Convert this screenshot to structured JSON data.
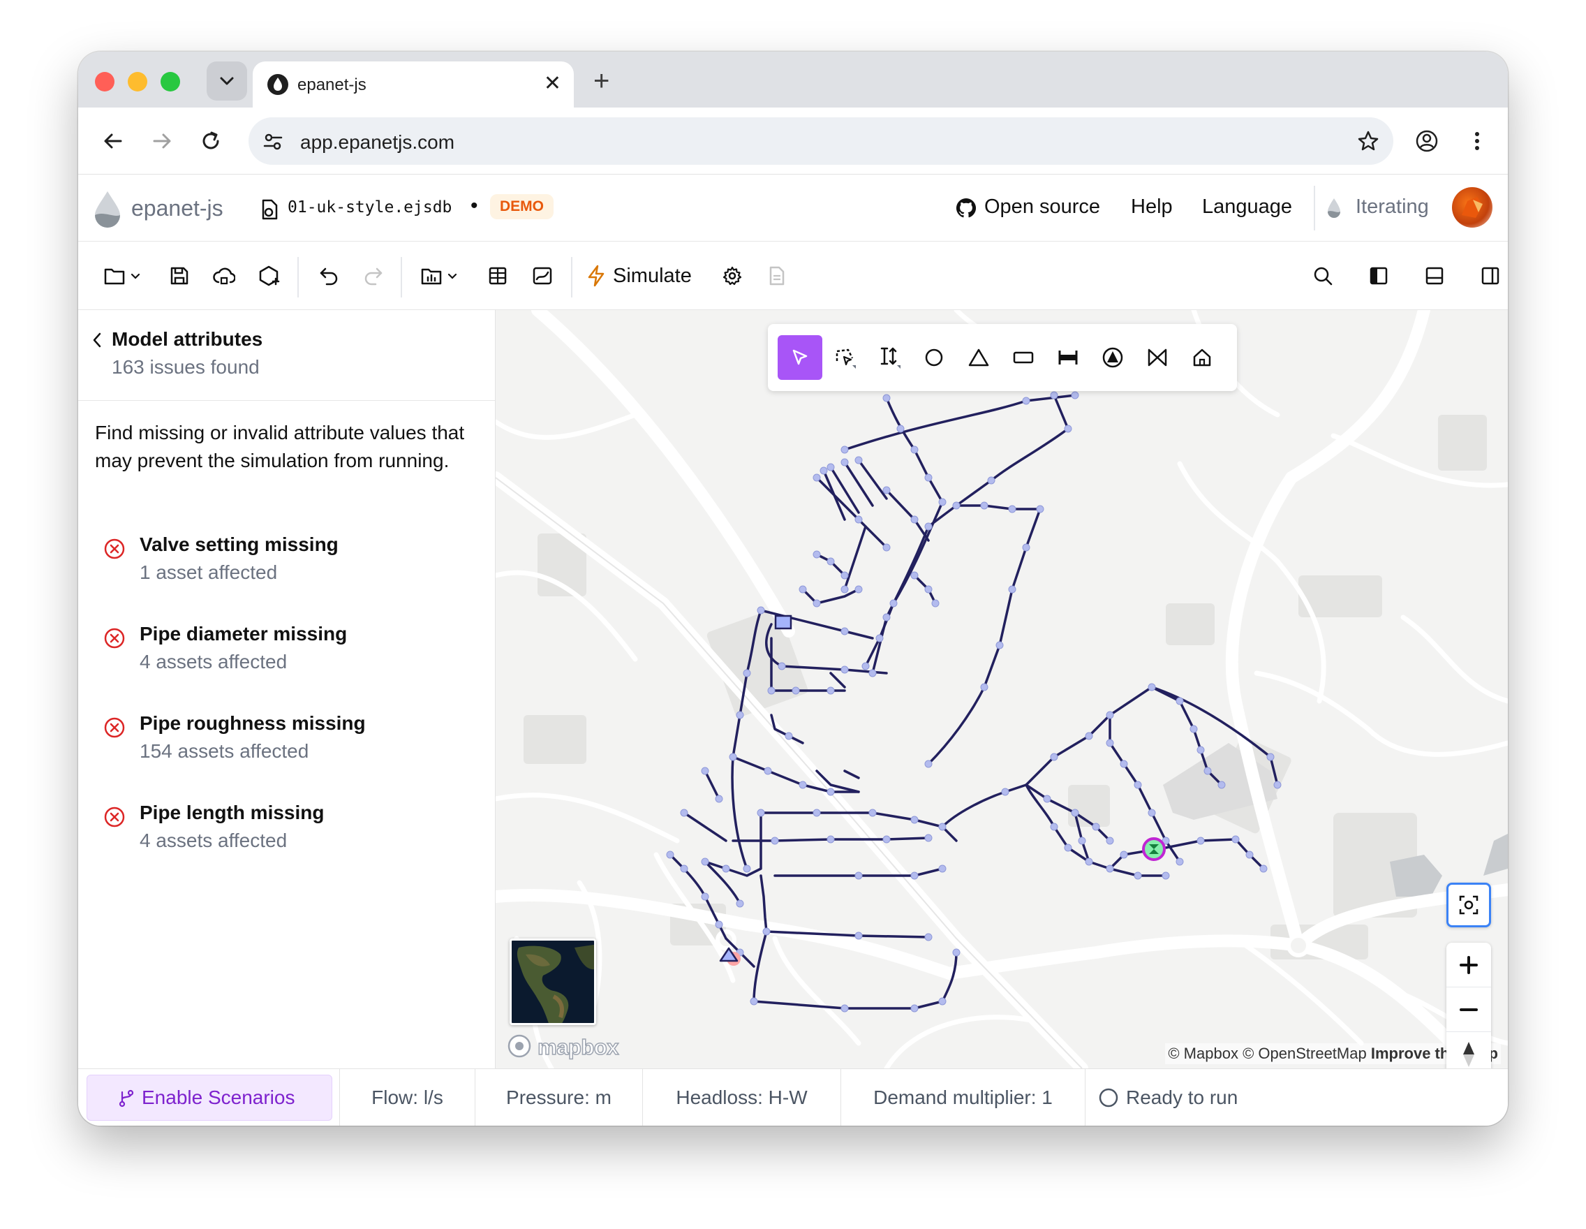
{
  "browser": {
    "tab_title": "epanet-js",
    "url": "app.epanetjs.com"
  },
  "header": {
    "brand": "epanet-js",
    "filename": "01-uk-style.ejsdb",
    "unsaved_dot": "•",
    "badge": "DEMO",
    "links": {
      "open_source": "Open source",
      "help": "Help",
      "language": "Language"
    },
    "status": "Iterating"
  },
  "toolbar": {
    "simulate_label": "Simulate"
  },
  "sidebar": {
    "title": "Model attributes",
    "subtitle": "163 issues found",
    "description": "Find missing or invalid attribute values that may prevent the simulation from running.",
    "issues": [
      {
        "title": "Valve setting missing",
        "count": "1 asset affected"
      },
      {
        "title": "Pipe diameter missing",
        "count": "4 assets affected"
      },
      {
        "title": "Pipe roughness missing",
        "count": "154 assets affected"
      },
      {
        "title": "Pipe length missing",
        "count": "4 assets affected"
      }
    ]
  },
  "map": {
    "logo": "mapbox",
    "attribution_mapbox": "© Mapbox",
    "attribution_osm": "© OpenStreetMap",
    "attribution_improve": "Improve this map",
    "draw_tools": [
      "select-icon",
      "lasso-icon",
      "connect-icon",
      "junction-icon",
      "reservoir-icon",
      "tank-icon",
      "pipe-icon",
      "pump-icon",
      "valve-icon",
      "customer-icon"
    ]
  },
  "statusbar": {
    "scenarios": "Enable Scenarios",
    "flow": "Flow: l/s",
    "pressure": "Pressure: m",
    "headloss": "Headloss: H-W",
    "demand": "Demand multiplier: 1",
    "run": "Ready to run"
  },
  "colors": {
    "accent": "#a855f7",
    "pipe": "#22205e",
    "node": "#b3bbee",
    "error": "#dc2626"
  }
}
